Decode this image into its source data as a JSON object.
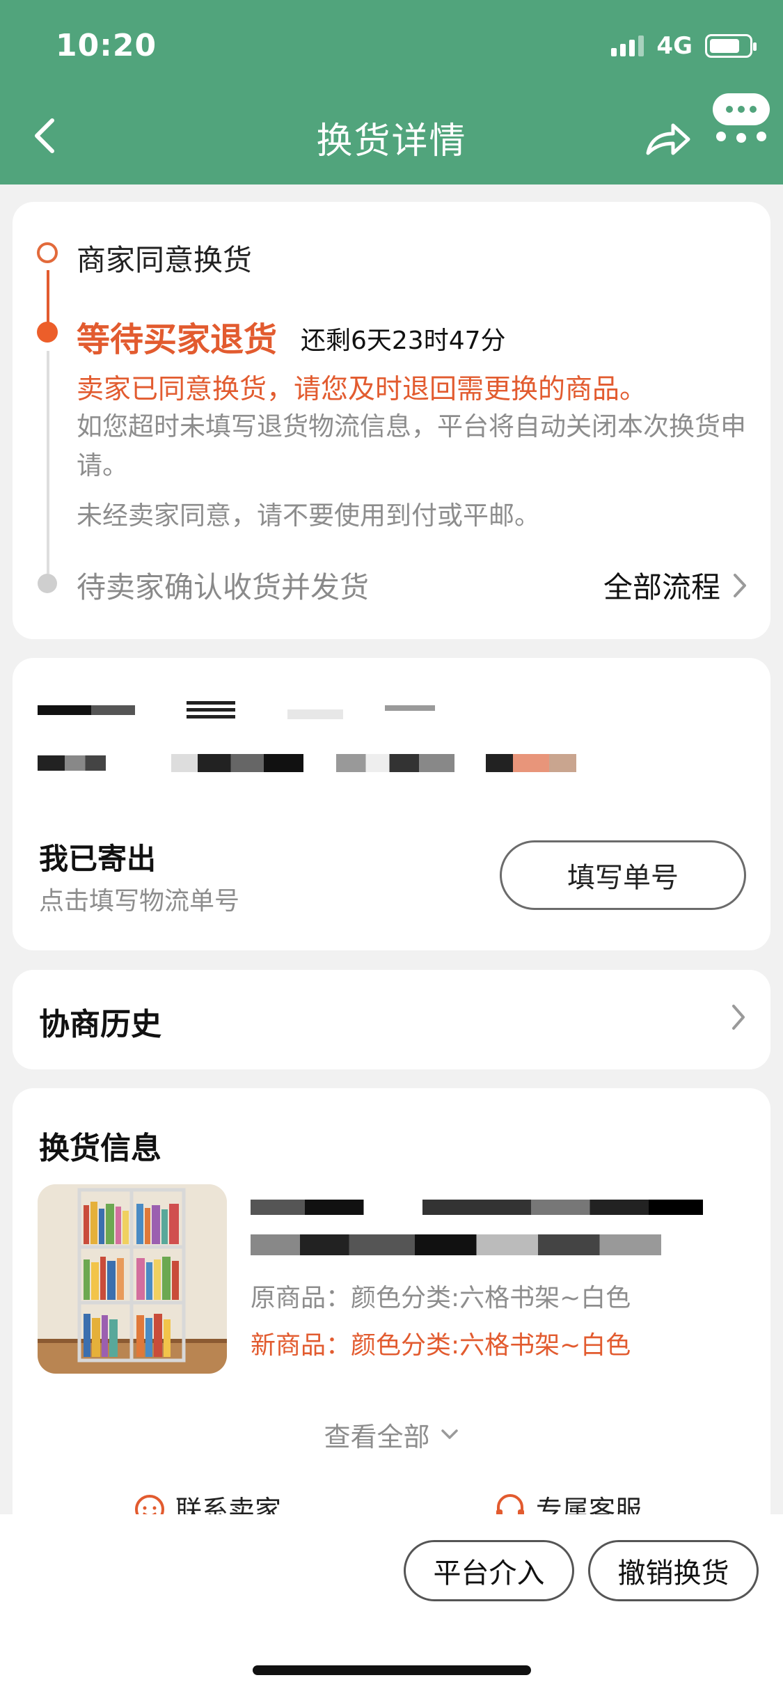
{
  "status_bar": {
    "time": "10:20",
    "network": "4G",
    "battery_level": 0.75
  },
  "header": {
    "title": "换货详情"
  },
  "progress": {
    "step_done": "商家同意换货",
    "current_title": "等待买家退货",
    "current_remaining": "还剩6天23时47分",
    "current_notice": "卖家已同意换货，请您及时退回需更换的商品。",
    "current_desc1": "如您超时未填写退货物流信息，平台将自动关闭本次换货申请。",
    "current_desc2": "未经卖家同意，请不要使用到付或平邮。",
    "step_next": "待卖家确认收货并发货",
    "all_flow_label": "全部流程"
  },
  "shipping": {
    "title": "我已寄出",
    "hint": "点击填写物流单号",
    "fill_button": "填写单号"
  },
  "history": {
    "title": "协商历史"
  },
  "exchange": {
    "title": "换货信息",
    "original_spec": "原商品：颜色分类:六格书架~白色",
    "new_spec": "新商品：颜色分类:六格书架~白色",
    "view_all": "查看全部",
    "contact_seller": "联系卖家",
    "exclusive_service": "专属客服"
  },
  "bottom_actions": {
    "platform": "平台介入",
    "cancel": "撤销换货"
  },
  "colors": {
    "header_green": "#51a47c",
    "accent_orange": "#e25b2f"
  },
  "icons": [
    "back-arrow-icon",
    "share-icon",
    "chat-bubble-icon",
    "chevron-right-icon",
    "chevron-down-icon",
    "seller-face-icon",
    "headset-icon"
  ]
}
